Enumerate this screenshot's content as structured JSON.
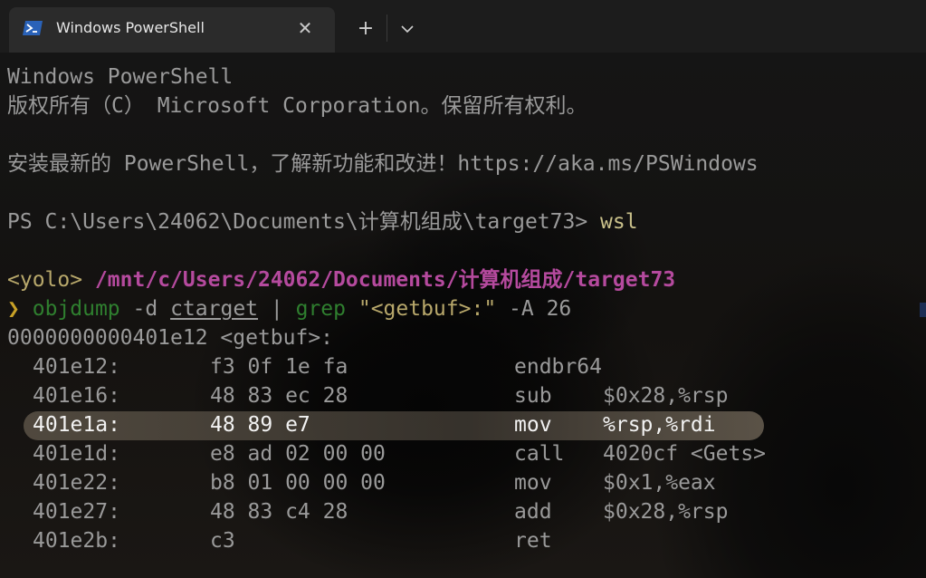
{
  "window": {
    "tab_title": "Windows PowerShell",
    "close_glyph": "✕",
    "new_tab_glyph": "+",
    "icon": "powershell-icon"
  },
  "colors": {
    "prompt_purple": "#b54a9e",
    "command_green": "#2f7f2f",
    "arrow_yellow": "#c9a227",
    "highlight": "#5a5246"
  },
  "terminal": {
    "banner_title": "Windows PowerShell",
    "copyright": "版权所有（C） Microsoft Corporation。保留所有权利。",
    "update_notice": "安装最新的 PowerShell，了解新功能和改进！https://aka.ms/PSWindows",
    "ps_prompt": "PS C:\\Users\\24062\\Documents\\计算机组成\\target73> ",
    "ps_command": "wsl",
    "shell_host": "<yolo>",
    "shell_path": "/mnt/c/Users/24062/Documents/计算机组成/target73",
    "arrow": "❯",
    "cmd_objdump": "objdump",
    "cmd_flag_d": "-d",
    "cmd_target": "ctarget",
    "cmd_pipe": "|",
    "cmd_grep": "grep",
    "cmd_pattern": "\"<getbuf>:\"",
    "cmd_flag_a": "-A 26",
    "func_header": "0000000000401e12 <getbuf>:",
    "disasm": [
      {
        "addr": "401e12:",
        "bytes": "f3 0f 1e fa",
        "mnemonic": "endbr64",
        "operands": ""
      },
      {
        "addr": "401e16:",
        "bytes": "48 83 ec 28",
        "mnemonic": "sub",
        "operands": "$0x28,%rsp"
      },
      {
        "addr": "401e1a:",
        "bytes": "48 89 e7",
        "mnemonic": "mov",
        "operands": "%rsp,%rdi"
      },
      {
        "addr": "401e1d:",
        "bytes": "e8 ad 02 00 00",
        "mnemonic": "call",
        "operands": "4020cf <Gets>"
      },
      {
        "addr": "401e22:",
        "bytes": "b8 01 00 00 00",
        "mnemonic": "mov",
        "operands": "$0x1,%eax"
      },
      {
        "addr": "401e27:",
        "bytes": "48 83 c4 28",
        "mnemonic": "add",
        "operands": "$0x28,%rsp"
      },
      {
        "addr": "401e2b:",
        "bytes": "c3",
        "mnemonic": "ret",
        "operands": ""
      }
    ]
  }
}
